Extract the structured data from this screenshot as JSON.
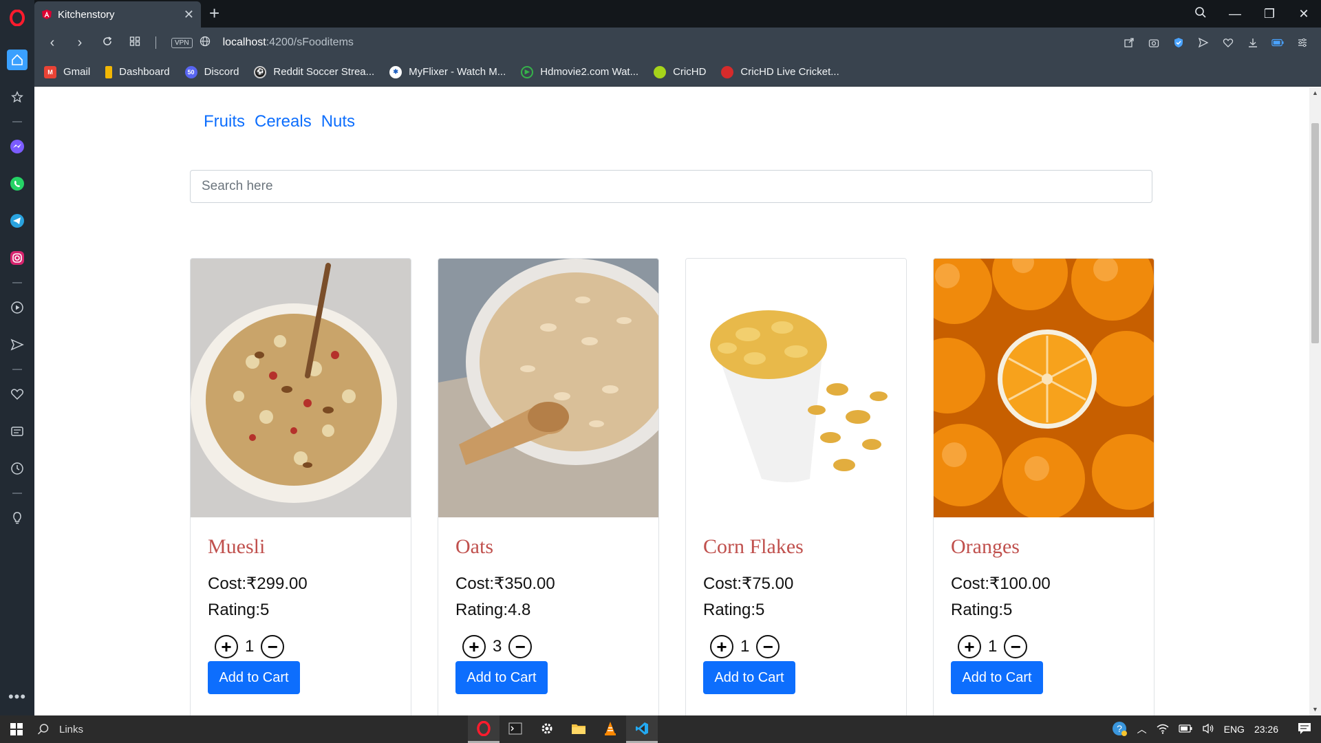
{
  "browser": {
    "tab_title": "Kitchenstory",
    "url_host": "localhost",
    "url_path": ":4200/sFooditems",
    "vpn_label": "VPN"
  },
  "bookmarks": [
    {
      "label": "Gmail",
      "icon": "gmail-icon",
      "color": "#ea4335"
    },
    {
      "label": "Dashboard",
      "icon": "dashboard-icon",
      "color": "#f2b705"
    },
    {
      "label": "Discord",
      "icon": "discord-icon",
      "color": "#5865f2"
    },
    {
      "label": "Reddit Soccer Strea...",
      "icon": "soccer-icon",
      "color": "#1b1b1b"
    },
    {
      "label": "MyFlixer - Watch M...",
      "icon": "film-icon",
      "color": "#1f5fbf"
    },
    {
      "label": "Hdmovie2.com Wat...",
      "icon": "play-icon",
      "color": "#36b34a"
    },
    {
      "label": "CricHD",
      "icon": "ball-icon",
      "color": "#a6d41a"
    },
    {
      "label": "CricHD Live Cricket...",
      "icon": "cricket-ball-icon",
      "color": "#d62b2b"
    }
  ],
  "categories": [
    "Fruits",
    "Cereals",
    "Nuts"
  ],
  "search": {
    "placeholder": "Search here"
  },
  "products": [
    {
      "name": "Muesli",
      "cost": "Cost:₹299.00",
      "rating": "Rating:5",
      "qty": "1",
      "add_label": "Add to Cart"
    },
    {
      "name": "Oats",
      "cost": "Cost:₹350.00",
      "rating": "Rating:4.8",
      "qty": "3",
      "add_label": "Add to Cart"
    },
    {
      "name": "Corn Flakes",
      "cost": "Cost:₹75.00",
      "rating": "Rating:5",
      "qty": "1",
      "add_label": "Add to Cart"
    },
    {
      "name": "Oranges",
      "cost": "Cost:₹100.00",
      "rating": "Rating:5",
      "qty": "1",
      "add_label": "Add to Cart"
    }
  ],
  "taskbar": {
    "search_label": "Links",
    "lang": "ENG",
    "time": "23:26"
  },
  "colors": {
    "accent": "#0d6efd",
    "title_red": "#c0504d",
    "chrome_dark": "#39434e",
    "sidebar": "#222a33"
  }
}
